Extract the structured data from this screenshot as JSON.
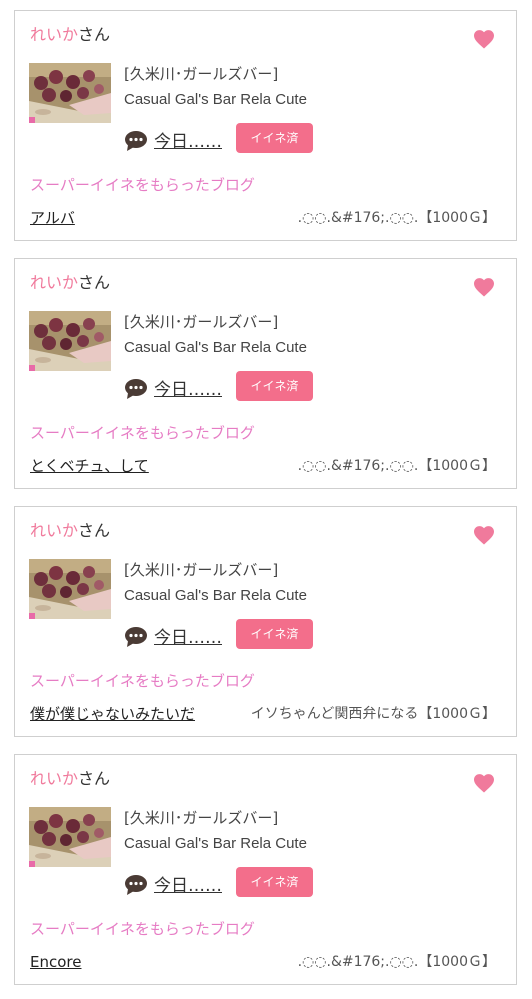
{
  "colors": {
    "pink": "#f07a9c",
    "like_button": "#f36e8b",
    "super_like": "#e67cc4",
    "border": "#cfcfcf"
  },
  "icons": {
    "heart": "heart-icon",
    "comment": "speech-bubble-icon"
  },
  "cards": [
    {
      "user_name": "れいか",
      "user_suffix": "さん",
      "shop_area": "[久米川･ガールズバー]",
      "shop_name": "Casual Gal's Bar Rela Cute",
      "comment_text": "今日……",
      "like_label": "イイネ済",
      "super_like_label": "スーパーイイネをもらったブログ",
      "blog_title": "アルバ",
      "blog_meta": ".◌◌.&#176;.◌◌.【1000Ｇ】"
    },
    {
      "user_name": "れいか",
      "user_suffix": "さん",
      "shop_area": "[久米川･ガールズバー]",
      "shop_name": "Casual Gal's Bar Rela Cute",
      "comment_text": "今日……",
      "like_label": "イイネ済",
      "super_like_label": "スーパーイイネをもらったブログ",
      "blog_title": "とくベチュ、して",
      "blog_meta": ".◌◌.&#176;.◌◌.【1000Ｇ】"
    },
    {
      "user_name": "れいか",
      "user_suffix": "さん",
      "shop_area": "[久米川･ガールズバー]",
      "shop_name": "Casual Gal's Bar Rela Cute",
      "comment_text": "今日……",
      "like_label": "イイネ済",
      "super_like_label": "スーパーイイネをもらったブログ",
      "blog_title": "僕が僕じゃないみたいだ",
      "blog_meta": "イソちゃんど関西弁になる【1000Ｇ】"
    },
    {
      "user_name": "れいか",
      "user_suffix": "さん",
      "shop_area": "[久米川･ガールズバー]",
      "shop_name": "Casual Gal's Bar Rela Cute",
      "comment_text": "今日……",
      "like_label": "イイネ済",
      "super_like_label": "スーパーイイネをもらったブログ",
      "blog_title": "Encore",
      "blog_meta": ".◌◌.&#176;.◌◌.【1000Ｇ】"
    }
  ]
}
